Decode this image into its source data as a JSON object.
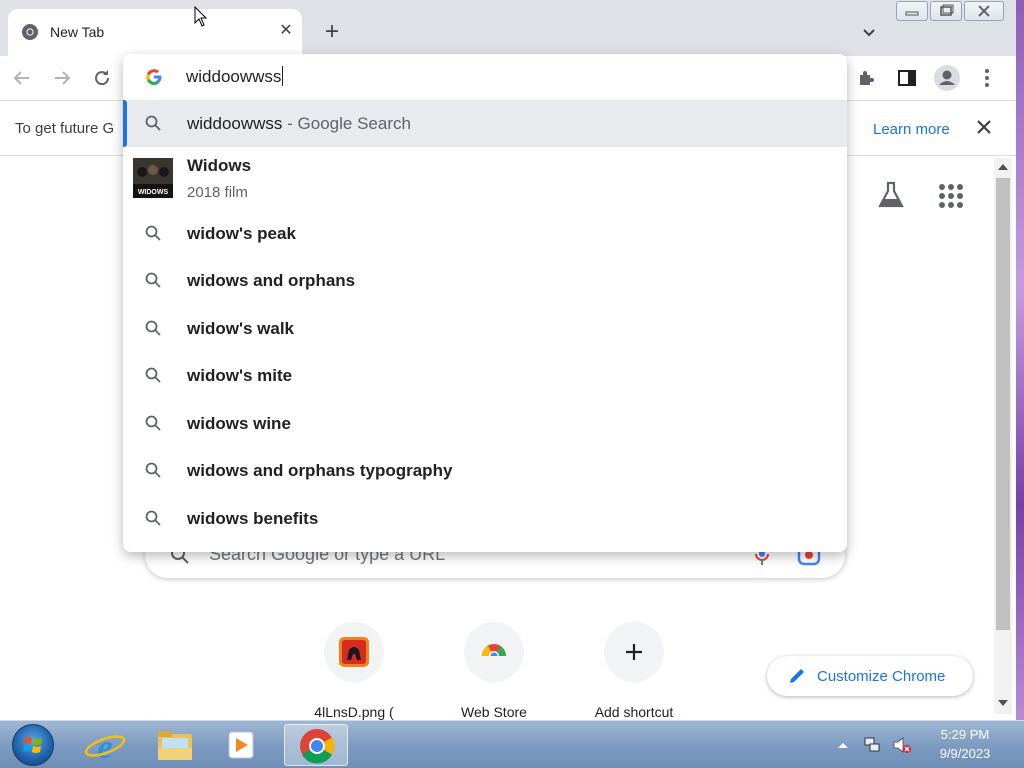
{
  "browser": {
    "tab": {
      "title": "New Tab"
    },
    "omnibox": {
      "value": "widdoowwss"
    },
    "infobar": {
      "text": "To get future G",
      "learn_more": "Learn more"
    }
  },
  "suggestions": {
    "search_row": {
      "query": "widdoowwss",
      "separator": " - ",
      "provider": "Google Search"
    },
    "entity": {
      "title": "Widows",
      "subtitle": "2018 film",
      "thumb_text": "WIDOWS"
    },
    "items": [
      "widow's peak",
      "widows and orphans",
      "widow's walk",
      "widow's mite",
      "widows wine",
      "widows and orphans typography",
      "widows benefits"
    ]
  },
  "ntp": {
    "search_placeholder": "Search Google or type a URL",
    "shortcuts": [
      {
        "label": "4lLnsD.png ("
      },
      {
        "label": "Web Store"
      },
      {
        "label": "Add shortcut"
      }
    ],
    "customize_label": "Customize Chrome"
  },
  "taskbar": {
    "time": "5:29 PM",
    "date": "9/9/2023"
  },
  "colors": {
    "accent": "#1a73e8",
    "tab_strip": "#dee1e6",
    "selected_row": "#e8eaed"
  }
}
